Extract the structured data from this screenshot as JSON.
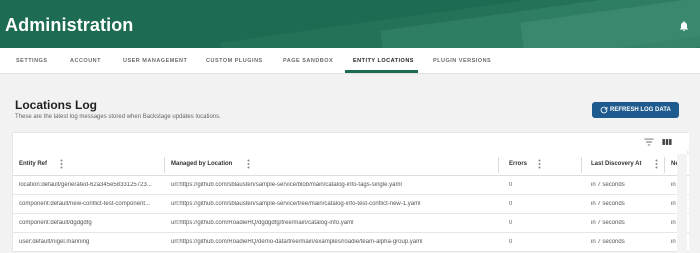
{
  "app": {
    "title": "Administration",
    "bell_icon": "bell-icon",
    "header_color": "#1d6b52"
  },
  "tabs": [
    {
      "label": "SETTINGS"
    },
    {
      "label": "ACCOUNT"
    },
    {
      "label": "USER MANAGEMENT"
    },
    {
      "label": "CUSTOM PLUGINS"
    },
    {
      "label": "PAGE SANDBOX"
    },
    {
      "label": "ENTITY LOCATIONS",
      "active": true
    },
    {
      "label": "PLUGIN VERSIONS"
    }
  ],
  "page": {
    "title": "Locations Log",
    "subtitle": "These are the latest log messages stored when Backstage updates locations.",
    "refresh_label": "REFRESH LOG DATA",
    "refresh_color": "#1f5a8f"
  },
  "table": {
    "columns": [
      "Entity Ref",
      "Managed by Location",
      "Errors",
      "Last Discovery At",
      "Ne"
    ],
    "rows": [
      {
        "entity": "location:default/generated-62a345e5833125723...",
        "location": "url:https://github.com/sblausten/sample-service/blob/main/catalog-info-tags-single.yaml",
        "errors": "0",
        "last_discovery": "in 7 seconds",
        "next": "in"
      },
      {
        "entity": "component:default/new-conflict-test-component...",
        "location": "url:https://github.com/sblausten/sample-service/tree/main/catalog-info-test-conflict-new-1.yaml",
        "errors": "0",
        "last_discovery": "in 7 seconds",
        "next": "in"
      },
      {
        "entity": "component:default/dgdgdfg",
        "location": "url:https://github.com/RoadieHQ/dgdgdfg/tree/main/catalog-info.yaml",
        "errors": "0",
        "last_discovery": "in 7 seconds",
        "next": "in"
      },
      {
        "entity": "user:default/nigel.manning",
        "location": "url:https://github.com/RoadieHQ/demo-data/tree/main/examples/roadie/team-alpha-group.yaml",
        "errors": "0",
        "last_discovery": "in 7 seconds",
        "next": "in"
      }
    ]
  }
}
